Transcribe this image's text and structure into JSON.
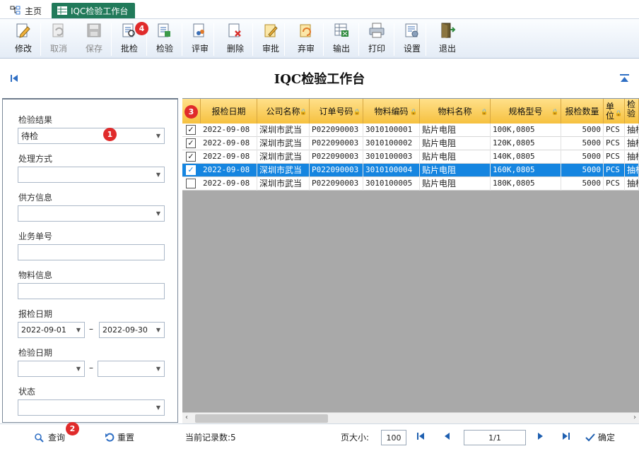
{
  "tabs": {
    "home": "主页",
    "active": "IQC检验工作台"
  },
  "toolbar": [
    {
      "label": "修改",
      "icon": "edit-icon",
      "enabled": true
    },
    {
      "label": "取消",
      "icon": "undo-icon",
      "enabled": false
    },
    {
      "label": "保存",
      "icon": "save-icon",
      "enabled": false
    },
    {
      "label": "批检",
      "icon": "batch-inspect-icon",
      "enabled": true
    },
    {
      "label": "检验",
      "icon": "inspect-icon",
      "enabled": true
    },
    {
      "label": "评审",
      "icon": "review-icon",
      "enabled": true
    },
    {
      "label": "删除",
      "icon": "delete-icon",
      "enabled": true
    },
    {
      "label": "审批",
      "icon": "approve-icon",
      "enabled": true
    },
    {
      "label": "弃审",
      "icon": "unapprove-icon",
      "enabled": true
    },
    {
      "label": "输出",
      "icon": "export-icon",
      "enabled": true
    },
    {
      "label": "打印",
      "icon": "print-icon",
      "enabled": true
    },
    {
      "label": "设置",
      "icon": "settings-icon",
      "enabled": true
    },
    {
      "label": "退出",
      "icon": "exit-icon",
      "enabled": true
    }
  ],
  "badges": {
    "b1": "1",
    "b2": "2",
    "b3": "3",
    "b4": "4"
  },
  "page_title": "IQC检验工作台",
  "filters": {
    "result_label": "检验结果",
    "result_value": "待检",
    "handling_label": "处理方式",
    "handling_value": "",
    "supplier_label": "供方信息",
    "supplier_value": "",
    "order_label": "业务单号",
    "order_value": "",
    "material_label": "物料信息",
    "material_value": "",
    "report_date_label": "报检日期",
    "report_date_from": "2022-09-01",
    "report_date_to": "2022-09-30",
    "inspect_date_label": "检验日期",
    "inspect_date_from": "",
    "inspect_date_to": "",
    "status_label": "状态",
    "status_value": "",
    "range_sep": "–"
  },
  "columns": [
    "报检日期",
    "公司名称",
    "订单号码",
    "物料编码",
    "物料名称",
    "规格型号",
    "报检数量",
    "单位",
    "检验"
  ],
  "rows": [
    {
      "checked": true,
      "selected": false,
      "date": "2022-09-08",
      "company": "深圳市武当",
      "order": "P022090003",
      "code": "3010100001",
      "name": "贴片电阻",
      "spec": "100K,0805",
      "qty": "5000",
      "unit": "PCS",
      "method": "抽检"
    },
    {
      "checked": true,
      "selected": false,
      "date": "2022-09-08",
      "company": "深圳市武当",
      "order": "P022090003",
      "code": "3010100002",
      "name": "贴片电阻",
      "spec": "120K,0805",
      "qty": "5000",
      "unit": "PCS",
      "method": "抽检"
    },
    {
      "checked": true,
      "selected": false,
      "date": "2022-09-08",
      "company": "深圳市武当",
      "order": "P022090003",
      "code": "3010100003",
      "name": "贴片电阻",
      "spec": "140K,0805",
      "qty": "5000",
      "unit": "PCS",
      "method": "抽检"
    },
    {
      "checked": true,
      "selected": true,
      "date": "2022-09-08",
      "company": "深圳市武当",
      "order": "P022090003",
      "code": "3010100004",
      "name": "贴片电阻",
      "spec": "160K,0805",
      "qty": "5000",
      "unit": "PCS",
      "method": "抽检"
    },
    {
      "checked": false,
      "selected": false,
      "date": "2022-09-08",
      "company": "深圳市武当",
      "order": "P022090003",
      "code": "3010100005",
      "name": "贴片电阻",
      "spec": "180K,0805",
      "qty": "5000",
      "unit": "PCS",
      "method": "抽检"
    }
  ],
  "footer": {
    "query": "查询",
    "reset": "重置",
    "record_count": "当前记录数:5",
    "page_size_label": "页大小:",
    "page_size": "100",
    "page_info": "1/1",
    "confirm": "确定"
  }
}
